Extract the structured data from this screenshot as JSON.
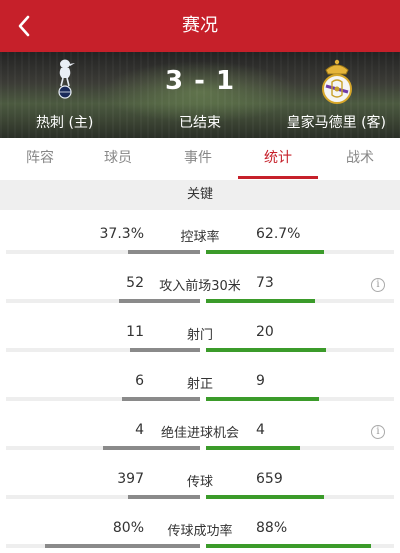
{
  "header": {
    "title": "赛况",
    "back_icon": "chevron-left-icon"
  },
  "match": {
    "home_team": "热刺 (主)",
    "away_team": "皇家马德里 (客)",
    "score": "3 - 1",
    "status": "已结束"
  },
  "tabs": [
    {
      "label": "阵容"
    },
    {
      "label": "球员"
    },
    {
      "label": "事件"
    },
    {
      "label": "统计",
      "active": true
    },
    {
      "label": "战术"
    }
  ],
  "section": {
    "title": "关键"
  },
  "stats": [
    {
      "label": "控球率",
      "home": "37.3%",
      "away": "62.7%",
      "home_ratio": 0.373,
      "away_ratio": 0.627,
      "info": false
    },
    {
      "label": "攻入前场30米",
      "home": "52",
      "away": "73",
      "home_ratio": 0.42,
      "away_ratio": 0.58,
      "info": true
    },
    {
      "label": "射门",
      "home": "11",
      "away": "20",
      "home_ratio": 0.36,
      "away_ratio": 0.64,
      "info": false
    },
    {
      "label": "射正",
      "home": "6",
      "away": "9",
      "home_ratio": 0.4,
      "away_ratio": 0.6,
      "info": false
    },
    {
      "label": "绝佳进球机会",
      "home": "4",
      "away": "4",
      "home_ratio": 0.5,
      "away_ratio": 0.5,
      "info": true
    },
    {
      "label": "传球",
      "home": "397",
      "away": "659",
      "home_ratio": 0.37,
      "away_ratio": 0.63,
      "info": false
    },
    {
      "label": "传球成功率",
      "home": "80%",
      "away": "88%",
      "home_ratio": 0.8,
      "away_ratio": 0.88,
      "info": false
    }
  ],
  "colors": {
    "brand": "#c6202a",
    "home_bar": "#8a8a8a",
    "away_bar": "#3b9b2a"
  }
}
